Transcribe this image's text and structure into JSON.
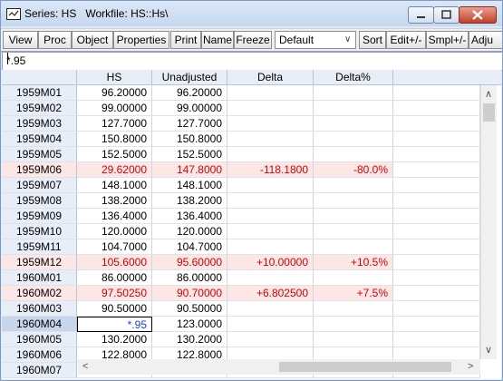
{
  "window": {
    "title": "Series: HS   Workfile: HS::Hs\\",
    "caption_buttons": {
      "minimize": "minimize-icon",
      "maximize": "maximize-icon",
      "close": "close-icon"
    }
  },
  "toolbar": {
    "view": "View",
    "proc": "Proc",
    "object": "Object",
    "properties": "Properties",
    "print": "Print",
    "name": "Name",
    "freeze": "Freeze",
    "format_select": "Default",
    "sort": "Sort",
    "edit": "Edit+/-",
    "smpl": "Smpl+/-",
    "adjust": "Adju"
  },
  "command": {
    "value": "*.95"
  },
  "table": {
    "columns": [
      "HS",
      "Unadjusted",
      "Delta",
      "Delta%"
    ],
    "rows": [
      {
        "date": "1959M01",
        "hs": "96.20000",
        "unadj": "96.20000",
        "delta": "",
        "pct": ""
      },
      {
        "date": "1959M02",
        "hs": "99.00000",
        "unadj": "99.00000",
        "delta": "",
        "pct": ""
      },
      {
        "date": "1959M03",
        "hs": "127.7000",
        "unadj": "127.7000",
        "delta": "",
        "pct": ""
      },
      {
        "date": "1959M04",
        "hs": "150.8000",
        "unadj": "150.8000",
        "delta": "",
        "pct": ""
      },
      {
        "date": "1959M05",
        "hs": "152.5000",
        "unadj": "152.5000",
        "delta": "",
        "pct": ""
      },
      {
        "date": "1959M06",
        "hs": "29.62000",
        "unadj": "147.8000",
        "delta": "-118.1800",
        "pct": "-80.0%"
      },
      {
        "date": "1959M07",
        "hs": "148.1000",
        "unadj": "148.1000",
        "delta": "",
        "pct": ""
      },
      {
        "date": "1959M08",
        "hs": "138.2000",
        "unadj": "138.2000",
        "delta": "",
        "pct": ""
      },
      {
        "date": "1959M09",
        "hs": "136.4000",
        "unadj": "136.4000",
        "delta": "",
        "pct": ""
      },
      {
        "date": "1959M10",
        "hs": "120.0000",
        "unadj": "120.0000",
        "delta": "",
        "pct": ""
      },
      {
        "date": "1959M11",
        "hs": "104.7000",
        "unadj": "104.7000",
        "delta": "",
        "pct": ""
      },
      {
        "date": "1959M12",
        "hs": "105.6000",
        "unadj": "95.60000",
        "delta": "+10.00000",
        "pct": "+10.5%"
      },
      {
        "date": "1960M01",
        "hs": "86.00000",
        "unadj": "86.00000",
        "delta": "",
        "pct": ""
      },
      {
        "date": "1960M02",
        "hs": "97.50250",
        "unadj": "90.70000",
        "delta": "+6.802500",
        "pct": "+7.5%"
      },
      {
        "date": "1960M03",
        "hs": "90.50000",
        "unadj": "90.50000",
        "delta": "",
        "pct": ""
      },
      {
        "date": "1960M04",
        "hs": "*.95",
        "unadj": "123.0000",
        "delta": "",
        "pct": ""
      },
      {
        "date": "1960M05",
        "hs": "130.2000",
        "unadj": "130.2000",
        "delta": "",
        "pct": ""
      },
      {
        "date": "1960M06",
        "hs": "122.8000",
        "unadj": "122.8000",
        "delta": "",
        "pct": ""
      },
      {
        "date": "1960M07",
        "hs": "",
        "unadj": "",
        "delta": "",
        "pct": ""
      }
    ],
    "highlight_rows": [
      5,
      11,
      13
    ],
    "editing_row": 15
  },
  "colors": {
    "highlight_bg": "#fde6e6",
    "highlight_text": "#d40000",
    "edit_text": "#1f3fe0"
  }
}
